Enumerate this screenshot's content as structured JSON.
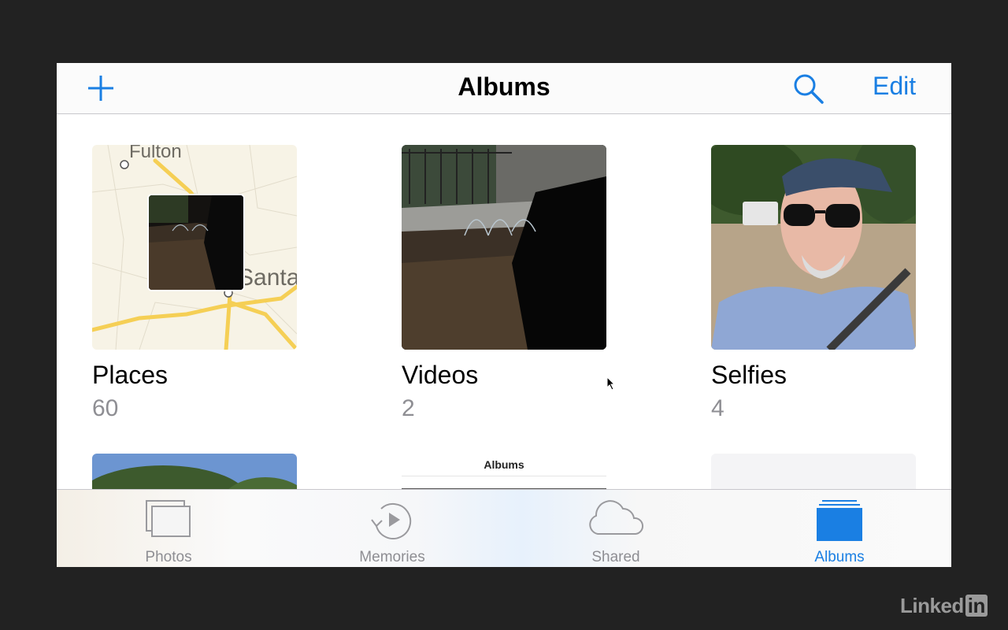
{
  "navbar": {
    "title": "Albums",
    "add_icon": "plus-icon",
    "search_icon": "search-icon",
    "edit_label": "Edit"
  },
  "albums": [
    {
      "title": "Places",
      "count": "60",
      "map_labels": [
        "Fulton",
        "Santa"
      ]
    },
    {
      "title": "Videos",
      "count": "2"
    },
    {
      "title": "Selfies",
      "count": "4"
    },
    {
      "title": "",
      "count": "",
      "partial": true
    },
    {
      "title": "",
      "count": "",
      "partial": true,
      "preview_label": "Albums"
    },
    {
      "title": "",
      "count": "",
      "partial": true
    }
  ],
  "tabbar": {
    "items": [
      {
        "label": "Photos",
        "icon": "photos-icon",
        "active": false
      },
      {
        "label": "Memories",
        "icon": "memories-icon",
        "active": false
      },
      {
        "label": "Shared",
        "icon": "cloud-icon",
        "active": false
      },
      {
        "label": "Albums",
        "icon": "albums-icon",
        "active": true
      }
    ]
  },
  "colors": {
    "accent": "#1a7fe3",
    "secondary_text": "#8e8e93",
    "background": "#222222"
  },
  "watermark": {
    "text": "Linked",
    "badge": "in"
  }
}
